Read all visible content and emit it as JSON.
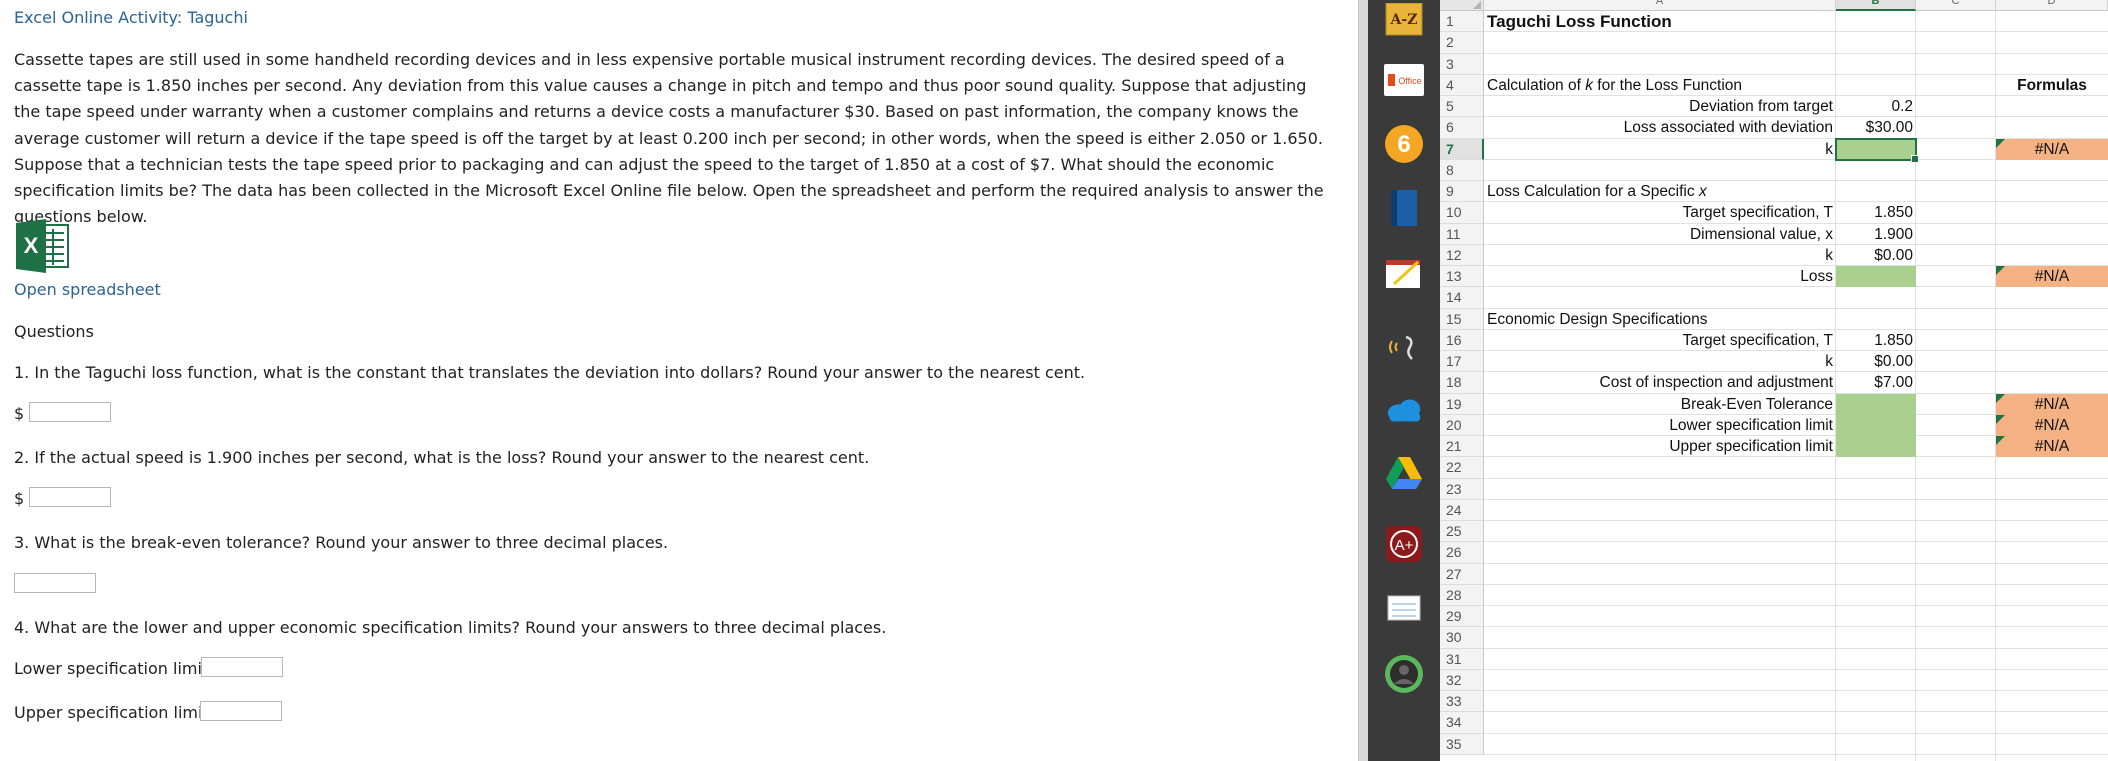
{
  "activity": {
    "title": "Excel Online Activity: Taguchi",
    "paragraph": "Cassette tapes are still used in some handheld recording devices and in less expensive portable musical instrument recording devices. The desired speed of a cassette tape is 1.850 inches per second. Any deviation from this value causes a change in pitch and tempo and thus poor sound quality. Suppose that adjusting the tape speed under warranty when a customer complains and returns a device costs a manufacturer $30. Based on past information, the company knows the average customer will return a device if the tape speed is off the target by at least 0.200 inch per second; in other words, when the speed is either 2.050 or 1.650. Suppose that a technician tests the tape speed prior to packaging and can adjust the speed to the target of 1.850 at a cost of $7. What should the economic specification limits be? The data has been collected in the Microsoft Excel Online file below. Open the spreadsheet and perform the required analysis to answer the questions below.",
    "open_link": "Open spreadsheet",
    "questions_heading": "Questions",
    "q1": "1. In the Taguchi loss function, what is the constant that translates the deviation into dollars? Round your answer to the nearest cent.",
    "q2": "2. If the actual speed is 1.900 inches per second, what is the loss? Round your answer to the nearest cent.",
    "q3": "3. What is the break-even tolerance? Round your answer to three decimal places.",
    "q4": "4. What are the lower and upper economic specification limits? Round your answers to three decimal places.",
    "dollar": "$",
    "lower_label": "Lower specification limit:",
    "upper_label": "Upper specification limit:",
    "answers": {
      "a1": "",
      "a2": "",
      "a3": "",
      "lower": "",
      "upper": ""
    }
  },
  "sidebar_icons": [
    "a-z-icon",
    "office-icon",
    "six-icon",
    "book-icon",
    "notepad-icon",
    "voice-icon",
    "onedrive-icon",
    "google-drive-icon",
    "a-plus-icon",
    "flashcard-icon",
    "avatar-icon"
  ],
  "az_label": "A-Z",
  "office_label": "Office",
  "six_label": "6",
  "aplus_label": "A+",
  "sheet": {
    "columns": [
      "A",
      "B",
      "C",
      "D"
    ],
    "selected_column": "B",
    "selected_row": 7,
    "rows": [
      "1",
      "2",
      "3",
      "4",
      "5",
      "6",
      "7",
      "8",
      "9",
      "10",
      "11",
      "12",
      "13",
      "14",
      "15",
      "16",
      "17",
      "18",
      "19",
      "20",
      "21",
      "22",
      "23",
      "24",
      "25",
      "26",
      "27",
      "28",
      "29",
      "30",
      "31",
      "32",
      "33",
      "34",
      "35"
    ],
    "title": "Taguchi Loss Function",
    "sec1_title_pre": "Calculation of ",
    "sec1_title_var": "k",
    "sec1_title_post": " for the Loss Function",
    "formulas_header": "Formulas",
    "deviation_label": "Deviation from target",
    "deviation_value": "0.2",
    "loss_dev_label": "Loss associated with deviation",
    "loss_dev_value": "$30.00",
    "k_label": "k",
    "na": "#N/A",
    "sec2_title_pre": "Loss Calculation for a Specific ",
    "sec2_title_var": "x",
    "target_label": "Target specification, T",
    "target_value": "1.850",
    "dim_label": "Dimensional value, x",
    "dim_value": "1.900",
    "k12_value": "$0.00",
    "loss_label": "Loss",
    "sec3_title": "Economic Design Specifications",
    "target16_value": "1.850",
    "k17_value": "$0.00",
    "cost_label": "Cost of inspection and adjustment",
    "cost_value": "$7.00",
    "be_label": "Break-Even Tolerance",
    "lsl_label": "Lower specification limit",
    "usl_label": "Upper specification limit"
  },
  "colors": {
    "green": "#a9d08e",
    "orange": "#f4b183",
    "excel_green": "#217346",
    "link": "#2a6496"
  }
}
